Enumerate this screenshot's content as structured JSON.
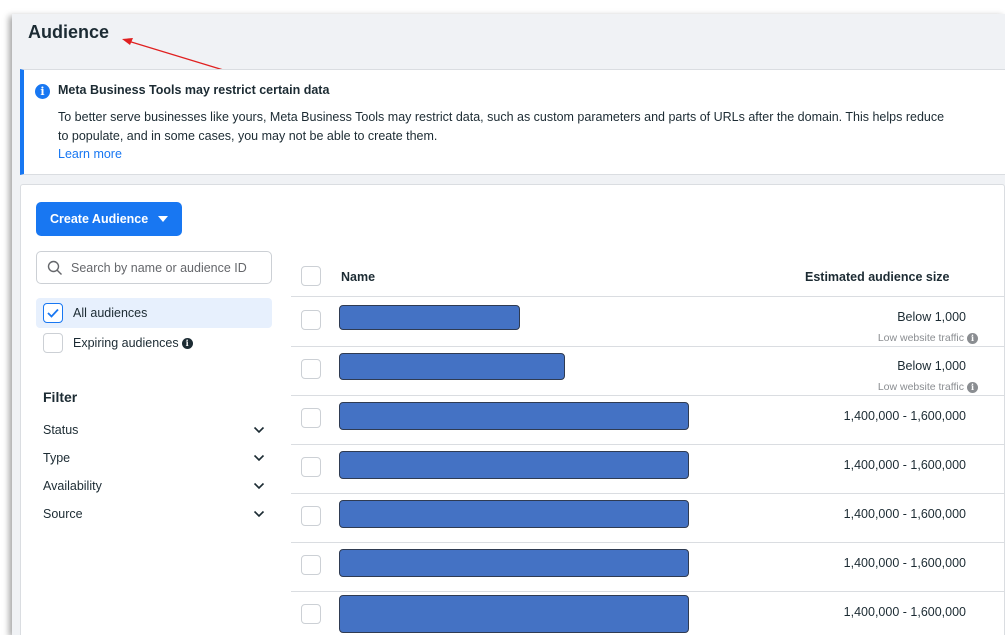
{
  "page": {
    "title": "Audience"
  },
  "notice": {
    "title": "Meta Business Tools may restrict certain data",
    "body": "To better serve businesses like yours, Meta Business Tools may restrict data, such as custom parameters and parts of URLs after the domain. This helps reduce\nto populate, and in some cases, you may not be able to create them.",
    "link": "Learn more",
    "icon": "info-icon"
  },
  "toolbar": {
    "create_label": "Create Audience"
  },
  "search": {
    "placeholder": "Search by name or audience ID",
    "value": ""
  },
  "audience_filters": [
    {
      "label": "All audiences",
      "checked": true
    },
    {
      "label": "Expiring audiences",
      "checked": false
    }
  ],
  "filter": {
    "title": "Filter",
    "items": [
      "Status",
      "Type",
      "Availability",
      "Source"
    ]
  },
  "table": {
    "columns": {
      "name": "Name",
      "size": "Estimated audience size"
    },
    "rows": [
      {
        "name": "",
        "size": "Below 1,000",
        "note": "Low website traffic"
      },
      {
        "name": "",
        "size": "Below 1,000",
        "note": "Low website traffic"
      },
      {
        "name": "",
        "size": "1,400,000 - 1,600,000",
        "note": ""
      },
      {
        "name": "",
        "size": "1,400,000 - 1,600,000",
        "note": ""
      },
      {
        "name": "",
        "size": "1,400,000 - 1,600,000",
        "note": ""
      },
      {
        "name": "",
        "size": "1,400,000 - 1,600,000",
        "note": ""
      },
      {
        "name": "",
        "size": "1,400,000 - 1,600,000",
        "note": ""
      }
    ]
  },
  "colors": {
    "accent": "#1877f2",
    "redaction": "#4472c4",
    "annotation_arrow": "#e02020"
  }
}
